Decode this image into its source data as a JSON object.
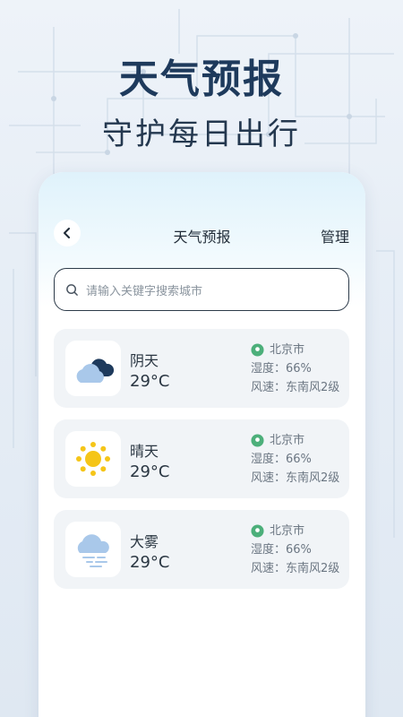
{
  "hero": {
    "title": "天气预报",
    "subtitle": "守护每日出行"
  },
  "nav": {
    "title": "天气预报",
    "manage_label": "管理"
  },
  "search": {
    "placeholder": "请输入关键字搜索城市"
  },
  "cards": [
    {
      "icon": "cloudy-icon",
      "condition": "阴天",
      "temp": "29°C",
      "location": "北京市",
      "humidity": "湿度：66%",
      "wind": "风速：东南风2级"
    },
    {
      "icon": "sunny-icon",
      "condition": "晴天",
      "temp": "29°C",
      "location": "北京市",
      "humidity": "湿度：66%",
      "wind": "风速：东南风2级"
    },
    {
      "icon": "fog-icon",
      "condition": "大雾",
      "temp": "29°C",
      "location": "北京市",
      "humidity": "湿度：66%",
      "wind": "风速：东南风2级"
    }
  ],
  "colors": {
    "accent_green": "#4caf7a",
    "hero_text": "#1e3a5c",
    "card_bg": "#f1f4f7"
  }
}
